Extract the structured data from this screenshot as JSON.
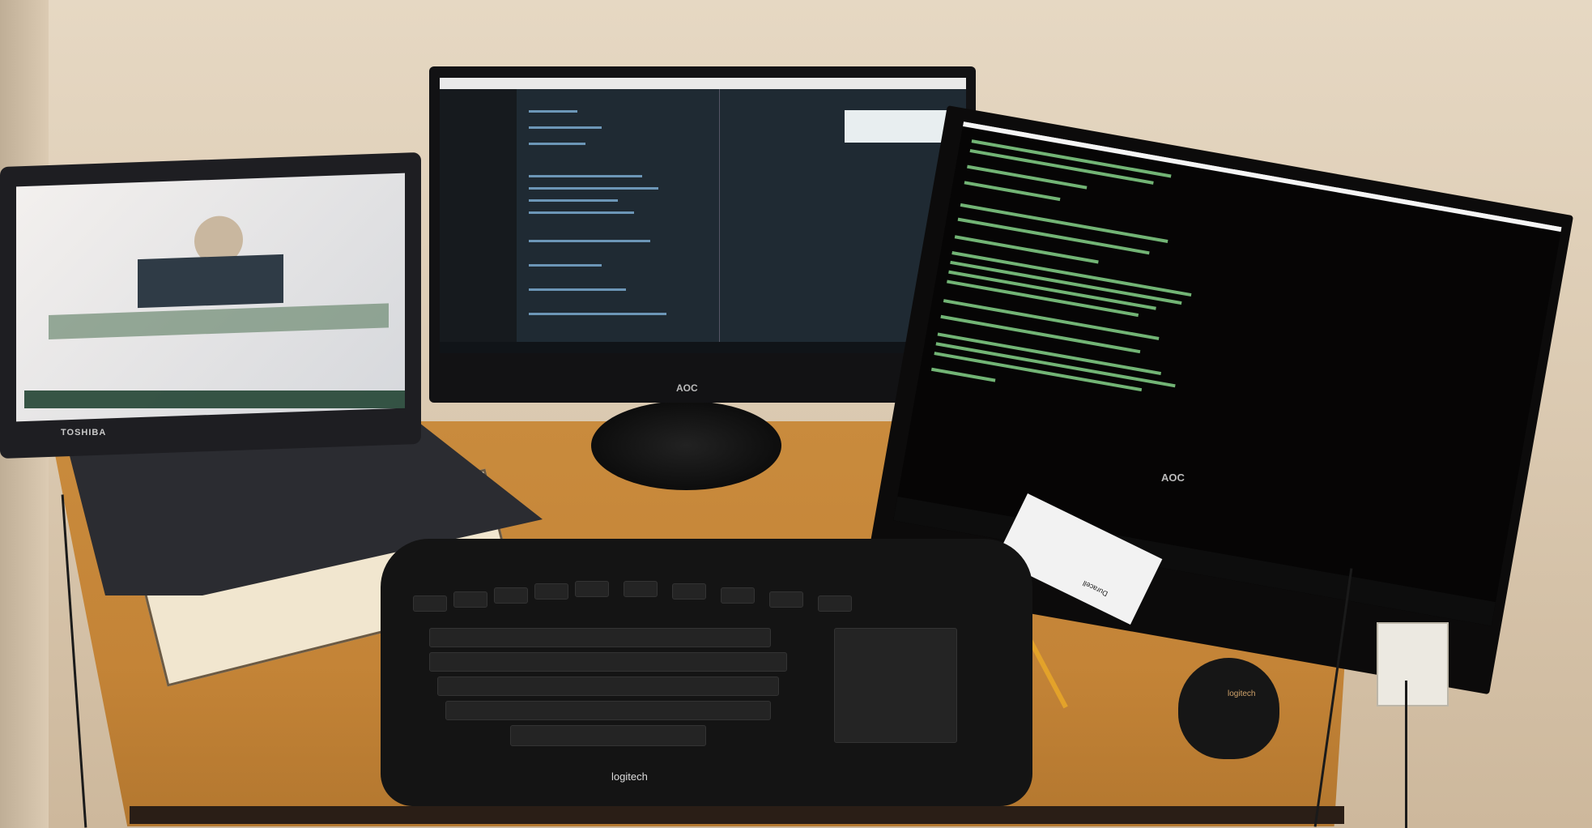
{
  "scene": {
    "description_labels": {
      "laptop_brand": "TOSHIBA",
      "center_monitor_brand": "AOC",
      "right_monitor_brand": "AOC",
      "keyboard_brand": "logitech",
      "mouse_brand": "logitech",
      "battery_pack_text": "Duracell"
    },
    "colors": {
      "wall": "#e6d8c3",
      "desk": "#c98b3d",
      "editor_bg": "#1f2a33",
      "terminal_bg": "#060505",
      "terminal_text": "#86d48a"
    }
  }
}
